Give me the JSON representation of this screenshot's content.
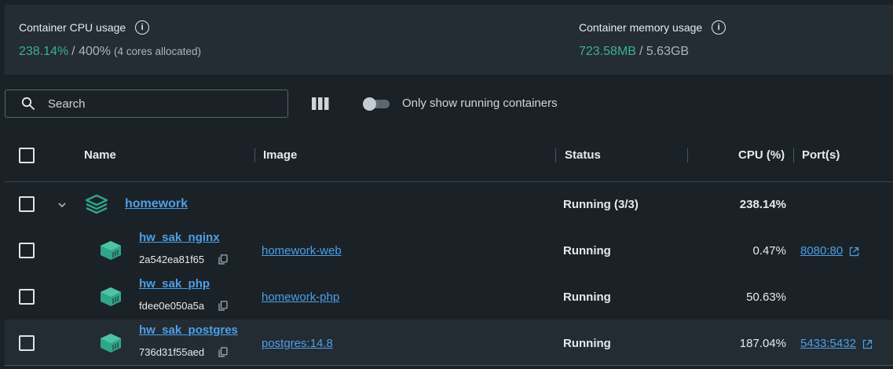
{
  "stats": {
    "cpu": {
      "label": "Container CPU usage",
      "value": "238.14%",
      "total": "/ 400%",
      "note": "(4 cores allocated)"
    },
    "memory": {
      "label": "Container memory usage",
      "value": "723.58MB",
      "total": "/ 5.63GB"
    }
  },
  "toolbar": {
    "search_placeholder": "Search",
    "toggle_label": "Only show running containers",
    "toggle_on": false
  },
  "table": {
    "headers": {
      "name": "Name",
      "image": "Image",
      "status": "Status",
      "cpu": "CPU (%)",
      "ports": "Port(s)"
    },
    "group": {
      "name": "homework",
      "status": "Running (3/3)",
      "cpu": "238.14%"
    },
    "rows": [
      {
        "name": "hw_sak_nginx",
        "id": "2a542ea81f65",
        "image": "homework-web",
        "status": "Running",
        "cpu": "0.47%",
        "port": "8080:80"
      },
      {
        "name": "hw_sak_php",
        "id": "fdee0e050a5a",
        "image": "homework-php",
        "status": "Running",
        "cpu": "50.63%",
        "port": ""
      },
      {
        "name": "hw_sak_postgres",
        "id": "736d31f55aed",
        "image": "postgres:14.8",
        "status": "Running",
        "cpu": "187.04%",
        "port": "5433:5432"
      }
    ]
  },
  "colors": {
    "accent_green": "#3fb08f",
    "link_blue": "#4d9fe8",
    "container_teal": "#2fa58b"
  },
  "icons": [
    "info-icon",
    "search-icon",
    "columns-icon",
    "chevron-down-icon",
    "stack-icon",
    "container-icon",
    "copy-icon",
    "external-link-icon"
  ]
}
